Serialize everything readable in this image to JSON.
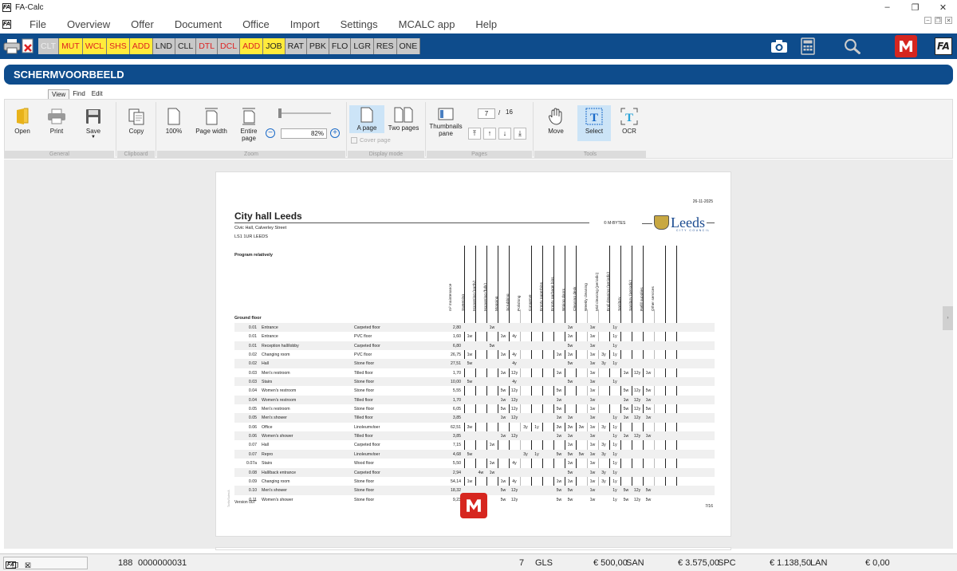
{
  "window": {
    "title": "FA-Calc",
    "minimize": "–",
    "restore": "❐",
    "close": "✕"
  },
  "menu": [
    "File",
    "Overview",
    "Offer",
    "Document",
    "Office",
    "Import",
    "Settings",
    "MCALC app",
    "Help"
  ],
  "toolbar": {
    "modules": [
      {
        "label": "CLT",
        "style": "disabled"
      },
      {
        "label": "MUT",
        "style": "yellow"
      },
      {
        "label": "WCL",
        "style": "yellow"
      },
      {
        "label": "SHS",
        "style": "yellow"
      },
      {
        "label": "ADD",
        "style": "yellow"
      },
      {
        "label": "LND",
        "style": "grey"
      },
      {
        "label": "CLL",
        "style": "grey"
      },
      {
        "label": "DTL",
        "style": "red"
      },
      {
        "label": "DCL",
        "style": "red"
      },
      {
        "label": "ADD",
        "style": "yellow"
      },
      {
        "label": "JOB",
        "style": "yellowblack"
      },
      {
        "label": "RAT",
        "style": "grey"
      },
      {
        "label": "PBK",
        "style": "grey"
      },
      {
        "label": "FLO",
        "style": "grey"
      },
      {
        "label": "LGR",
        "style": "grey"
      },
      {
        "label": "RES",
        "style": "grey"
      },
      {
        "label": "ONE",
        "style": "grey"
      }
    ],
    "fa_label": "FA",
    "m_label": "M"
  },
  "header": {
    "title": "SCHERMVOORBEELD"
  },
  "ribbon": {
    "tabs": [
      "View",
      "Find",
      "Edit"
    ],
    "groups": {
      "general": "General",
      "clipboard": "Clipboard",
      "zoom": "Zoom",
      "display_mode": "Display mode",
      "pages": "Pages",
      "tools": "Tools"
    },
    "buttons": {
      "open": "Open",
      "print": "Print",
      "save": "Save",
      "copy": "Copy",
      "zoom100": "100%",
      "page_width": "Page width",
      "entire_page": "Entire page",
      "a_page": "A page",
      "two_pages": "Two pages",
      "cover_page": "Cover page",
      "thumbnails": "Thumbnails pane",
      "move": "Move",
      "select": "Select",
      "ocr": "OCR"
    },
    "zoom_value": "82%",
    "page_current": "7",
    "page_sep": "/",
    "page_total": "16"
  },
  "document": {
    "date": "26-11-2025",
    "title": "City hall Leeds",
    "address1": "Civic Hall, Calverley Street",
    "address2": "LS1 1UR LEEDS",
    "credit": "© M-BYTES",
    "logo_name": "Leeds",
    "logo_sub": "CITY COUNCIL",
    "program": "Program relatively",
    "section": "Ground floor",
    "columns": [
      "m² maintenance",
      "Sweeping",
      "Hoovering (partly)",
      "Hoovering (fully)",
      "Mopping",
      "Scrubbing",
      "Polishing",
      "Conserve",
      "Empty paperbins",
      "Empty garbage bins",
      "Wiping doors",
      "Cleaning desk",
      "Weekly cleaning",
      "Mid cleaning (periodic)",
      "End cleaning (periodic)",
      "Sanitary",
      "Sanitary (periodic)",
      "Refill supplies",
      "Other services"
    ],
    "rows": [
      {
        "code": "0.01",
        "name": "Entrance",
        "floor": "Carpeted floor",
        "m2": "2,80",
        "c": [
          "",
          "",
          "1w",
          "",
          "",
          "",
          "",
          "",
          "",
          "1w",
          "",
          "1w",
          "",
          "1y",
          "",
          "",
          "",
          ""
        ]
      },
      {
        "code": "0.01",
        "name": "Entrance",
        "floor": "PVC floor",
        "m2": "1,60",
        "c": [
          "1w",
          "",
          "",
          "1w",
          "4y",
          "",
          "",
          "",
          "",
          "1w",
          "",
          "1w",
          "",
          "1y",
          "",
          "",
          "",
          ""
        ]
      },
      {
        "code": "0.01",
        "name": "Reception hall/lobby",
        "floor": "Carpeted floor",
        "m2": "6,80",
        "c": [
          "",
          "",
          "5w",
          "",
          "",
          "",
          "",
          "",
          "",
          "5w",
          "",
          "1w",
          "",
          "1y",
          "",
          "",
          "",
          ""
        ]
      },
      {
        "code": "0.02",
        "name": "Changing room",
        "floor": "PVC floor",
        "m2": "26,75",
        "c": [
          "1w",
          "",
          "",
          "1w",
          "4y",
          "",
          "",
          "",
          "1w",
          "1w",
          "",
          "1w",
          "3y",
          "1y",
          "",
          "",
          "",
          ""
        ]
      },
      {
        "code": "0.02",
        "name": "Hall",
        "floor": "Stone floor",
        "m2": "27,51",
        "c": [
          "5w",
          "",
          "",
          "",
          "4y",
          "",
          "",
          "",
          "",
          "5w",
          "",
          "1w",
          "3y",
          "1y",
          "",
          "",
          "",
          ""
        ]
      },
      {
        "code": "0.03",
        "name": "Men's restroom",
        "floor": "Tilled floor",
        "m2": "1,70",
        "c": [
          "",
          "",
          "",
          "1w",
          "12y",
          "",
          "",
          "",
          "1w",
          "",
          "",
          "1w",
          "",
          "",
          "1w",
          "12y",
          "1w",
          ""
        ]
      },
      {
        "code": "0.03",
        "name": "Stairs",
        "floor": "Stone floor",
        "m2": "10,00",
        "c": [
          "5w",
          "",
          "",
          "",
          "4y",
          "",
          "",
          "",
          "",
          "5w",
          "",
          "1w",
          "",
          "1y",
          "",
          "",
          "",
          ""
        ]
      },
      {
        "code": "0.04",
        "name": "Women's restroom",
        "floor": "Stone floor",
        "m2": "5,55",
        "c": [
          "",
          "",
          "",
          "5w",
          "12y",
          "",
          "",
          "",
          "5w",
          "",
          "",
          "1w",
          "",
          "",
          "5w",
          "12y",
          "5w",
          ""
        ]
      },
      {
        "code": "0.04",
        "name": "Women's restroom",
        "floor": "Tilled floor",
        "m2": "1,70",
        "c": [
          "",
          "",
          "",
          "1w",
          "12y",
          "",
          "",
          "",
          "1w",
          "",
          "",
          "1w",
          "",
          "",
          "1w",
          "12y",
          "1w",
          ""
        ]
      },
      {
        "code": "0.05",
        "name": "Men's restroom",
        "floor": "Stone floor",
        "m2": "6,05",
        "c": [
          "",
          "",
          "",
          "5w",
          "12y",
          "",
          "",
          "",
          "5w",
          "",
          "",
          "1w",
          "",
          "",
          "5w",
          "12y",
          "5w",
          ""
        ]
      },
      {
        "code": "0.05",
        "name": "Men's shower",
        "floor": "Tilled floor",
        "m2": "3,85",
        "c": [
          "",
          "",
          "",
          "1w",
          "12y",
          "",
          "",
          "",
          "1w",
          "1w",
          "",
          "1w",
          "",
          "1y",
          "1w",
          "12y",
          "1w",
          ""
        ]
      },
      {
        "code": "0.06",
        "name": "Office",
        "floor": "Linoleumvloer",
        "m2": "62,51",
        "c": [
          "3w",
          "",
          "",
          "",
          "",
          "3y",
          "1y",
          "",
          "3w",
          "3w",
          "3w",
          "1w",
          "3y",
          "1y",
          "",
          "",
          "",
          ""
        ]
      },
      {
        "code": "0.06",
        "name": "Women's shower",
        "floor": "Tilled floor",
        "m2": "3,85",
        "c": [
          "",
          "",
          "",
          "1w",
          "12y",
          "",
          "",
          "",
          "1w",
          "1w",
          "",
          "1w",
          "",
          "1y",
          "1w",
          "12y",
          "1w",
          ""
        ]
      },
      {
        "code": "0.07",
        "name": "Hall",
        "floor": "Carpeted floor",
        "m2": "7,15",
        "c": [
          "",
          "",
          "1w",
          "",
          "",
          "",
          "",
          "",
          "",
          "1w",
          "",
          "1w",
          "3y",
          "1y",
          "",
          "",
          "",
          ""
        ]
      },
      {
        "code": "0.07",
        "name": "Repro",
        "floor": "Linoleumvloer",
        "m2": "4,68",
        "c": [
          "5w",
          "",
          "",
          "",
          "",
          "3y",
          "1y",
          "",
          "5w",
          "5w",
          "5w",
          "1w",
          "3y",
          "1y",
          "",
          "",
          "",
          ""
        ]
      },
      {
        "code": "0.07a",
        "name": "Stairs",
        "floor": "Wood floor",
        "m2": "5,50",
        "c": [
          "",
          "",
          "1w",
          "",
          "4y",
          "",
          "",
          "",
          "",
          "1w",
          "",
          "1w",
          "",
          "1y",
          "",
          "",
          "",
          ""
        ]
      },
      {
        "code": "0.08",
        "name": "Hall/back entrance",
        "floor": "Carpeted floor",
        "m2": "2,94",
        "c": [
          "",
          "4w",
          "1w",
          "",
          "",
          "",
          "",
          "",
          "",
          "5w",
          "",
          "1w",
          "3y",
          "1y",
          "",
          "",
          "",
          ""
        ]
      },
      {
        "code": "0.09",
        "name": "Changing room",
        "floor": "Stone floor",
        "m2": "54,14",
        "c": [
          "1w",
          "",
          "",
          "1w",
          "4y",
          "",
          "",
          "",
          "1w",
          "1w",
          "",
          "1w",
          "3y",
          "1y",
          "",
          "",
          "",
          ""
        ]
      },
      {
        "code": "0.10",
        "name": "Men's shower",
        "floor": "Stone floor",
        "m2": "18,32",
        "c": [
          "",
          "",
          "",
          "5w",
          "12y",
          "",
          "",
          "",
          "5w",
          "5w",
          "",
          "1w",
          "",
          "1y",
          "5w",
          "12y",
          "5w",
          ""
        ]
      },
      {
        "code": "0.11",
        "name": "Women's shower",
        "floor": "Stone floor",
        "m2": "9,23",
        "c": [
          "",
          "",
          "",
          "5w",
          "12y",
          "",
          "",
          "",
          "5w",
          "5w",
          "",
          "1w",
          "",
          "1y",
          "5w",
          "12y",
          "5w",
          ""
        ]
      }
    ],
    "version": "Version 007",
    "page_number": "7/16",
    "side_text": "Tarifa/Sales/A"
  },
  "statusbar": {
    "count": "188",
    "code": "0000000031",
    "num": "7",
    "gls_label": "GLS",
    "gls_value": "€ 500,00",
    "san_label": "SAN",
    "san_value": "€ 3.575,00",
    "spc_label": "SPC",
    "spc_value": "€ 1.138,50",
    "lan_label": "LAN",
    "lan_value": "€ 0,00"
  }
}
